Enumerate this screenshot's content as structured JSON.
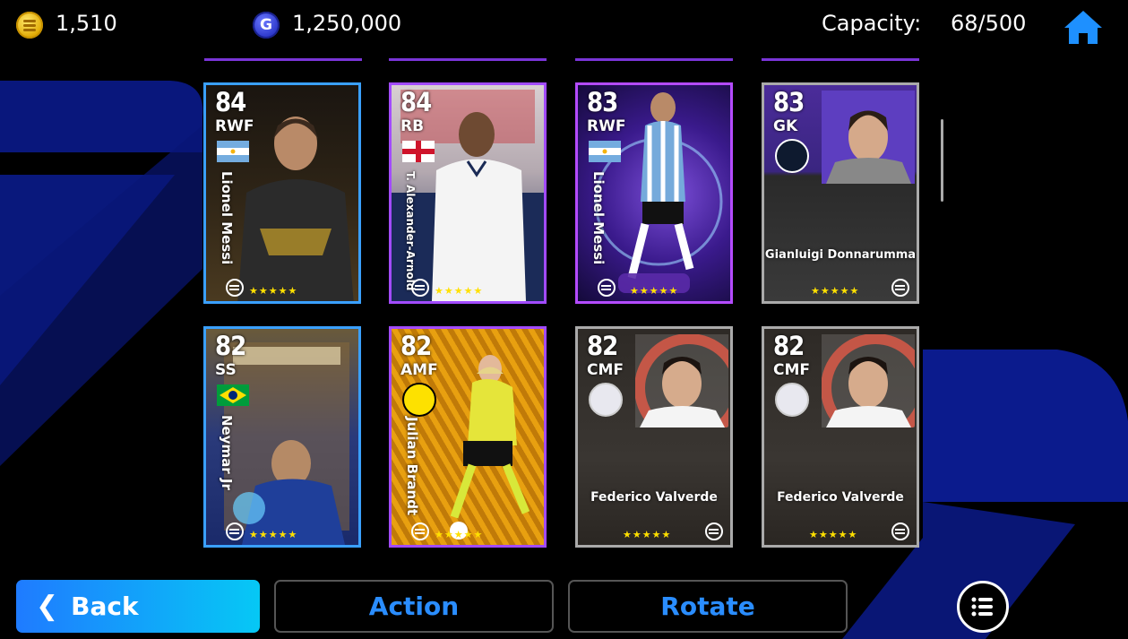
{
  "currency": {
    "coins": "1,510",
    "gp_icon_letter": "G",
    "gp": "1,250,000"
  },
  "capacity": {
    "label": "Capacity:",
    "value": "68/500"
  },
  "cards": [
    {
      "rating": "84",
      "position": "RWF",
      "name": "Lionel Messi",
      "name_style": "vertical",
      "flag": "argentina",
      "frame_color": "#3aa0ff"
    },
    {
      "rating": "84",
      "position": "RB",
      "name": "T. Alexander-Arnold",
      "name_style": "vertical",
      "flag": "england",
      "frame_color": "#a24bff"
    },
    {
      "rating": "83",
      "position": "RWF",
      "name": "Lionel Messi",
      "name_style": "vertical",
      "flag": "argentina",
      "frame_color": "#b44bff"
    },
    {
      "rating": "83",
      "position": "GK",
      "name": "Gianluigi Donnarumma",
      "name_style": "horizontal",
      "club": "club-badge",
      "frame_color": "#aaaaaa"
    },
    {
      "rating": "82",
      "position": "SS",
      "name": "Neymar Jr",
      "name_style": "vertical",
      "flag": "brazil",
      "frame_color": "#3aa0ff"
    },
    {
      "rating": "82",
      "position": "AMF",
      "name": "Julian Brandt",
      "name_style": "vertical",
      "club": "bvb-badge",
      "frame_color": "#a24bff"
    },
    {
      "rating": "82",
      "position": "CMF",
      "name": "Federico Valverde",
      "name_style": "horizontal",
      "club": "club-badge",
      "frame_color": "#aaaaaa"
    },
    {
      "rating": "82",
      "position": "CMF",
      "name": "Federico Valverde",
      "name_style": "horizontal",
      "club": "club-badge",
      "frame_color": "#aaaaaa"
    }
  ],
  "stars": "★★★★★",
  "buttons": {
    "back": "Back",
    "action": "Action",
    "rotate": "Rotate"
  },
  "colors": {
    "accent_blue": "#2a8dff",
    "back_gradient_start": "#1f7bff",
    "back_gradient_end": "#06c8f5",
    "star": "#ffe000"
  }
}
